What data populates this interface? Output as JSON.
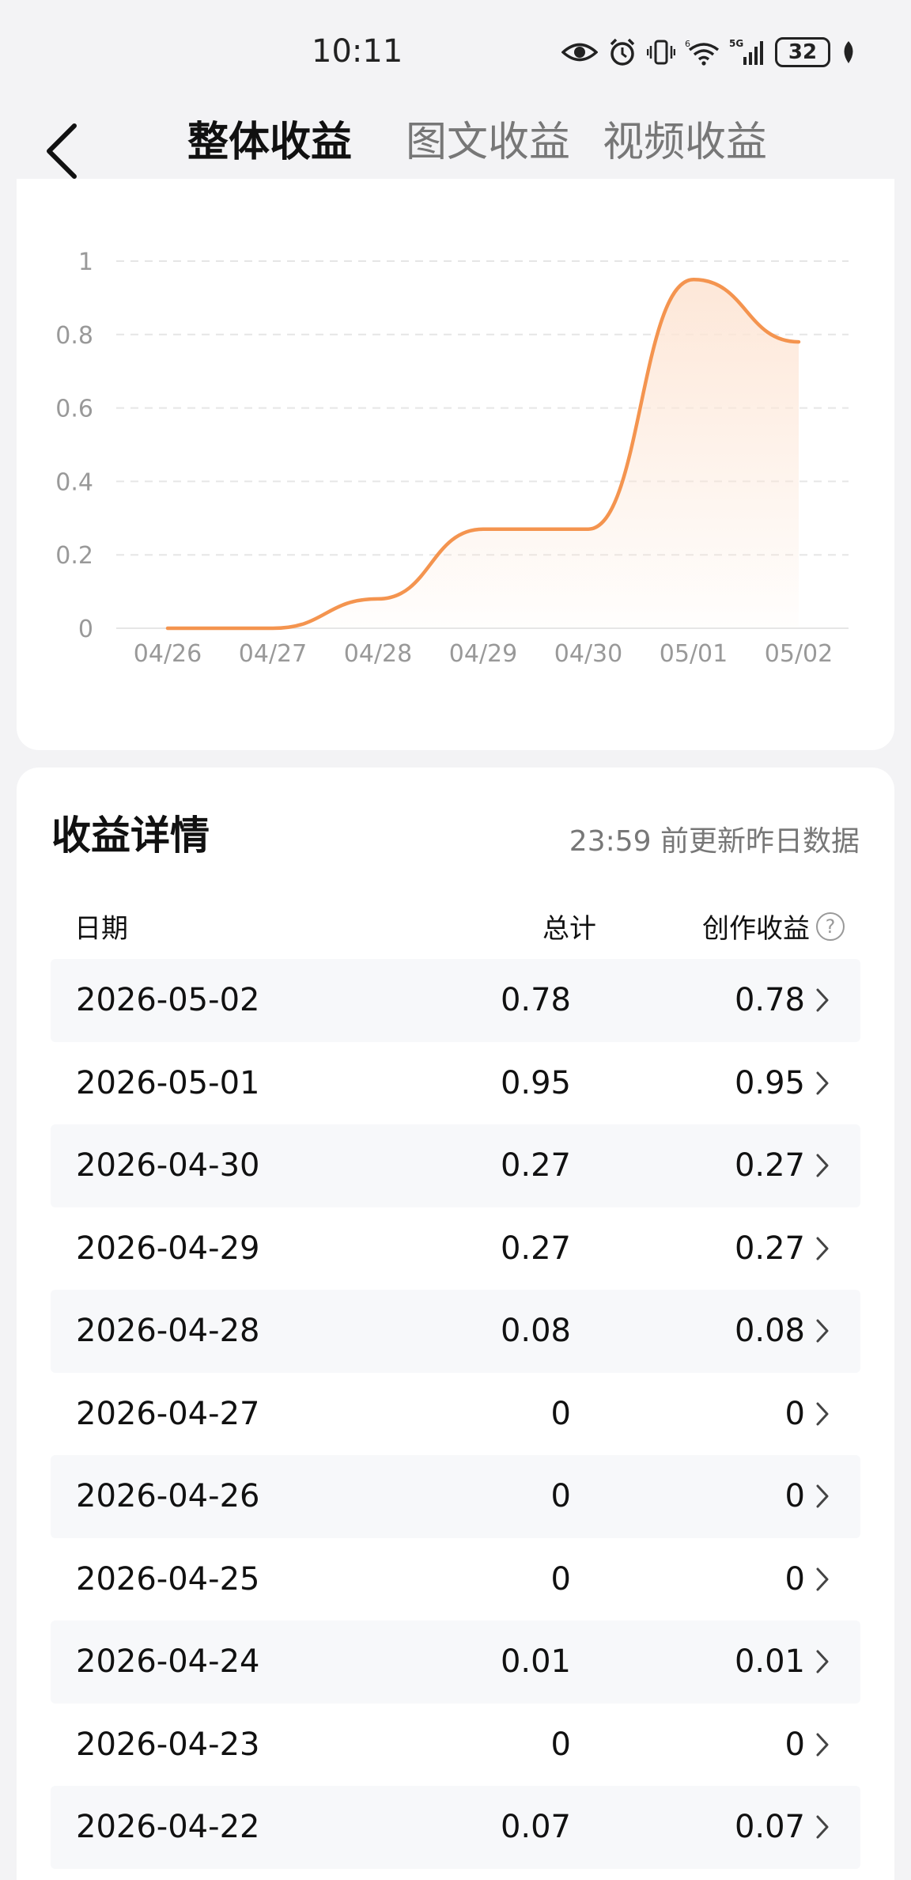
{
  "status_bar": {
    "time": "10:11",
    "icons": [
      "eye-icon",
      "alarm-icon",
      "vibrate-icon",
      "wifi-icon",
      "signal-5g-icon",
      "leaf-icon"
    ],
    "network_label": "5G",
    "battery": "32"
  },
  "nav": {
    "tabs": [
      {
        "label": "整体收益",
        "active": true
      },
      {
        "label": "图文收益",
        "active": false
      },
      {
        "label": "视频收益",
        "active": false
      }
    ]
  },
  "chart_data": {
    "type": "area",
    "title": "",
    "xlabel": "",
    "ylabel": "",
    "categories": [
      "04/26",
      "04/27",
      "04/28",
      "04/29",
      "04/30",
      "05/01",
      "05/02"
    ],
    "values": [
      0,
      0,
      0.08,
      0.27,
      0.27,
      0.95,
      0.78
    ],
    "y_ticks": [
      "0",
      "0.2",
      "0.4",
      "0.6",
      "0.8",
      "1"
    ],
    "ylim": [
      0,
      1
    ],
    "grid": true,
    "colors": {
      "line": "#F4944F",
      "fill": "#FDE6D6",
      "grid": "#E6E6E6",
      "tick": "#999999"
    }
  },
  "details": {
    "title": "收益详情",
    "update_note": "23:59 前更新昨日数据",
    "columns": {
      "date": "日期",
      "total": "总计",
      "creation": "创作收益"
    },
    "rows": [
      {
        "date": "2026-05-02",
        "total": "0.78",
        "creation": "0.78"
      },
      {
        "date": "2026-05-01",
        "total": "0.95",
        "creation": "0.95"
      },
      {
        "date": "2026-04-30",
        "total": "0.27",
        "creation": "0.27"
      },
      {
        "date": "2026-04-29",
        "total": "0.27",
        "creation": "0.27"
      },
      {
        "date": "2026-04-28",
        "total": "0.08",
        "creation": "0.08"
      },
      {
        "date": "2026-04-27",
        "total": "0",
        "creation": "0"
      },
      {
        "date": "2026-04-26",
        "total": "0",
        "creation": "0"
      },
      {
        "date": "2026-04-25",
        "total": "0",
        "creation": "0"
      },
      {
        "date": "2026-04-24",
        "total": "0.01",
        "creation": "0.01"
      },
      {
        "date": "2026-04-23",
        "total": "0",
        "creation": "0"
      },
      {
        "date": "2026-04-22",
        "total": "0.07",
        "creation": "0.07"
      }
    ]
  }
}
